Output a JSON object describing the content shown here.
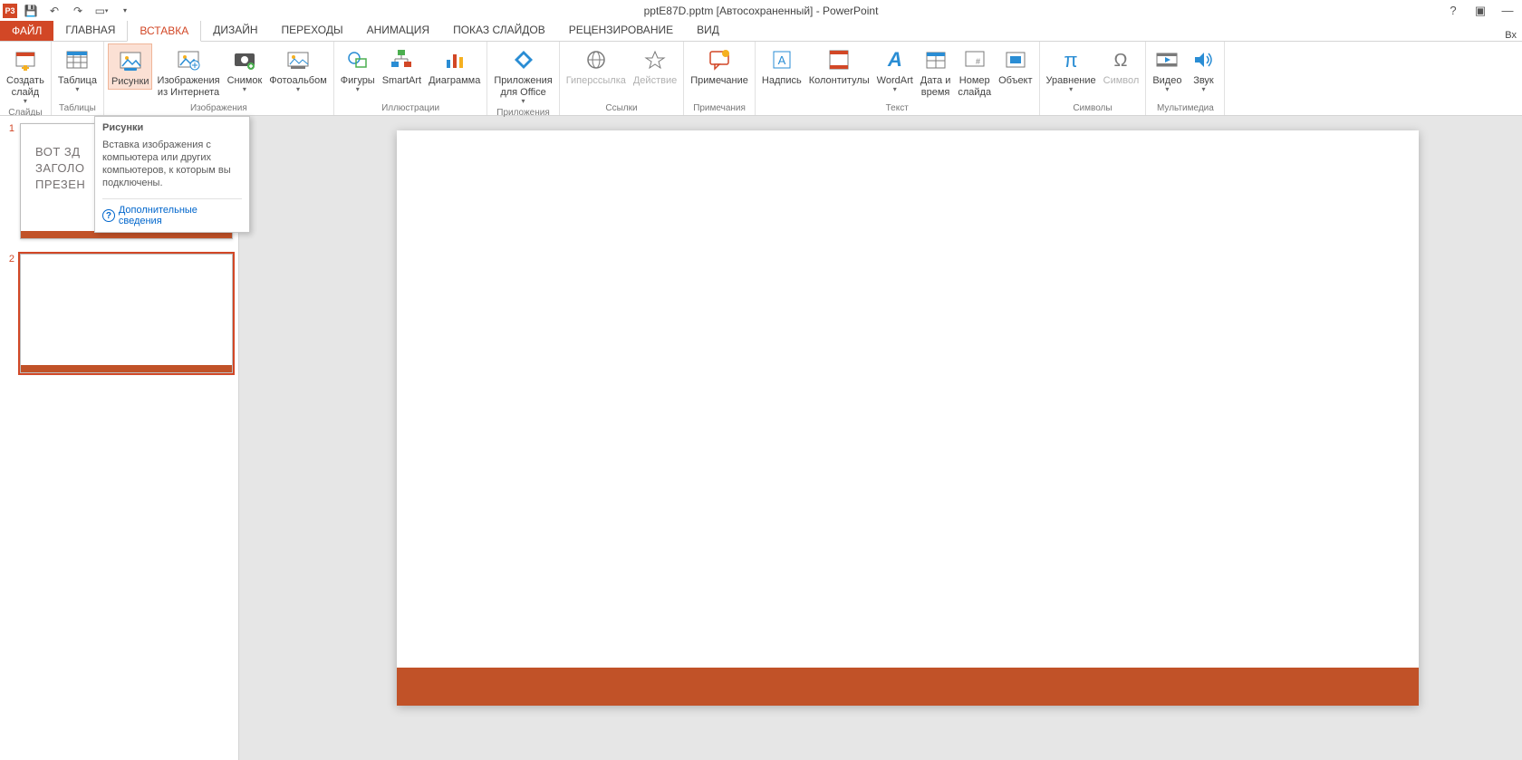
{
  "app": {
    "window_title": "pptE87D.pptm [Автосохраненный] - PowerPoint",
    "app_short": "P3",
    "signin": "Вх"
  },
  "tabs": {
    "file": "ФАЙЛ",
    "items": [
      "ГЛАВНАЯ",
      "ВСТАВКА",
      "ДИЗАЙН",
      "ПЕРЕХОДЫ",
      "АНИМАЦИЯ",
      "ПОКАЗ СЛАЙДОВ",
      "РЕЦЕНЗИРОВАНИЕ",
      "ВИД"
    ],
    "active_index": 1
  },
  "ribbon": {
    "groups": [
      {
        "label": "Слайды",
        "items": [
          {
            "name": "new-slide",
            "label": "Создать\nслайд",
            "dropdown": true
          }
        ]
      },
      {
        "label": "Таблицы",
        "items": [
          {
            "name": "table",
            "label": "Таблица",
            "dropdown": true
          }
        ]
      },
      {
        "label": "Изображения",
        "items": [
          {
            "name": "pictures",
            "label": "Рисунки",
            "highlighted": true
          },
          {
            "name": "online-pictures",
            "label": "Изображения\nиз Интернета"
          },
          {
            "name": "screenshot",
            "label": "Снимок",
            "dropdown": true
          },
          {
            "name": "photo-album",
            "label": "Фотоальбом",
            "dropdown": true
          }
        ]
      },
      {
        "label": "Иллюстрации",
        "items": [
          {
            "name": "shapes",
            "label": "Фигуры",
            "dropdown": true
          },
          {
            "name": "smartart",
            "label": "SmartArt"
          },
          {
            "name": "chart",
            "label": "Диаграмма"
          }
        ]
      },
      {
        "label": "Приложения",
        "items": [
          {
            "name": "apps",
            "label": "Приложения\nдля Office",
            "dropdown": true
          }
        ]
      },
      {
        "label": "Ссылки",
        "items": [
          {
            "name": "hyperlink",
            "label": "Гиперссылка",
            "disabled": true
          },
          {
            "name": "action",
            "label": "Действие",
            "disabled": true
          }
        ]
      },
      {
        "label": "Примечания",
        "items": [
          {
            "name": "comment",
            "label": "Примечание"
          }
        ]
      },
      {
        "label": "Текст",
        "items": [
          {
            "name": "text-box",
            "label": "Надпись"
          },
          {
            "name": "header-footer",
            "label": "Колонтитулы"
          },
          {
            "name": "wordart",
            "label": "WordArt",
            "dropdown": true
          },
          {
            "name": "date-time",
            "label": "Дата и\nвремя"
          },
          {
            "name": "slide-number",
            "label": "Номер\nслайда"
          },
          {
            "name": "object",
            "label": "Объект"
          }
        ]
      },
      {
        "label": "Символы",
        "items": [
          {
            "name": "equation",
            "label": "Уравнение",
            "dropdown": true
          },
          {
            "name": "symbol",
            "label": "Символ",
            "disabled": true
          }
        ]
      },
      {
        "label": "Мультимедиа",
        "items": [
          {
            "name": "video",
            "label": "Видео",
            "dropdown": true
          },
          {
            "name": "audio",
            "label": "Звук",
            "dropdown": true
          }
        ]
      }
    ]
  },
  "tooltip": {
    "title": "Рисунки",
    "body": "Вставка изображения с компьютера или других компьютеров, к которым вы подключены.",
    "link": "Дополнительные сведения"
  },
  "thumbnails": {
    "slides": [
      {
        "num": "1",
        "title_lines": [
          "ВОТ ЗД",
          "ЗАГОЛО",
          "ПРЕЗЕН"
        ],
        "selected": false
      },
      {
        "num": "2",
        "selected": true
      }
    ]
  },
  "icons": {
    "new-slide": "▭",
    "table": "▦",
    "pictures": "🖼",
    "online-pictures": "🖼",
    "screenshot": "📷",
    "photo-album": "🖥",
    "shapes": "◇",
    "smartart": "⬡",
    "chart": "📊",
    "apps": "◆",
    "hyperlink": "🔗",
    "action": "✦",
    "comment": "💬",
    "text-box": "A",
    "header-footer": "▤",
    "wordart": "A",
    "date-time": "▦",
    "slide-number": "#",
    "object": "▭",
    "equation": "π",
    "symbol": "Ω",
    "video": "▭",
    "audio": "🔊"
  }
}
